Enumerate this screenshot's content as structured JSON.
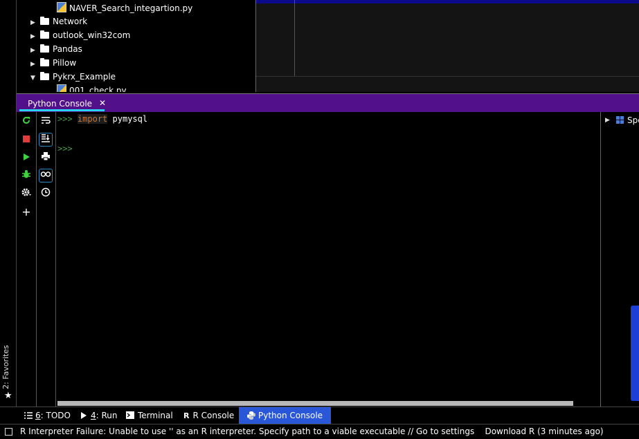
{
  "project_tree": {
    "items": [
      {
        "type": "file",
        "label": "NAVER_Search_integartion.py"
      },
      {
        "type": "folder",
        "label": "Network",
        "expanded": false
      },
      {
        "type": "folder",
        "label": "outlook_win32com",
        "expanded": false
      },
      {
        "type": "folder",
        "label": "Pandas",
        "expanded": false
      },
      {
        "type": "folder",
        "label": "Pillow",
        "expanded": false
      },
      {
        "type": "folder",
        "label": "Pykrx_Example",
        "expanded": true
      },
      {
        "type": "file",
        "label": "001_check.py"
      }
    ]
  },
  "tool_window": {
    "tab_label": "Python Console",
    "close_glyph": "✕"
  },
  "console": {
    "prompt": ">>>",
    "lines": [
      {
        "keyword": "import",
        "text": "pymysql"
      },
      {
        "keyword": "",
        "text": ""
      }
    ]
  },
  "variables_panel": {
    "label": "Spe"
  },
  "favorites": {
    "label": "2: Favorites"
  },
  "bottom_tabs": [
    {
      "mnemonic": "6",
      "label": ": TODO",
      "icon": "list-icon"
    },
    {
      "mnemonic": "4",
      "label": ": Run",
      "icon": "play-icon"
    },
    {
      "mnemonic": "",
      "label": "Terminal",
      "icon": "terminal-icon"
    },
    {
      "mnemonic": "",
      "label": "R Console",
      "icon": "r-icon"
    },
    {
      "mnemonic": "",
      "label": "Python Console",
      "icon": "python-icon",
      "active": true
    }
  ],
  "status_bar": {
    "text": "R Interpreter Failure: Unable to use '' as an R interpreter. Specify path to a viable executable // Go to settings    Download R (3 minutes ago)"
  },
  "colors": {
    "tool_header": "#52108a",
    "tab_underline": "#2ad4f0",
    "active_bottom_tab": "#2a56d8",
    "prompt_green": "#4a9f4a",
    "keyword_orange": "#cc7832"
  }
}
